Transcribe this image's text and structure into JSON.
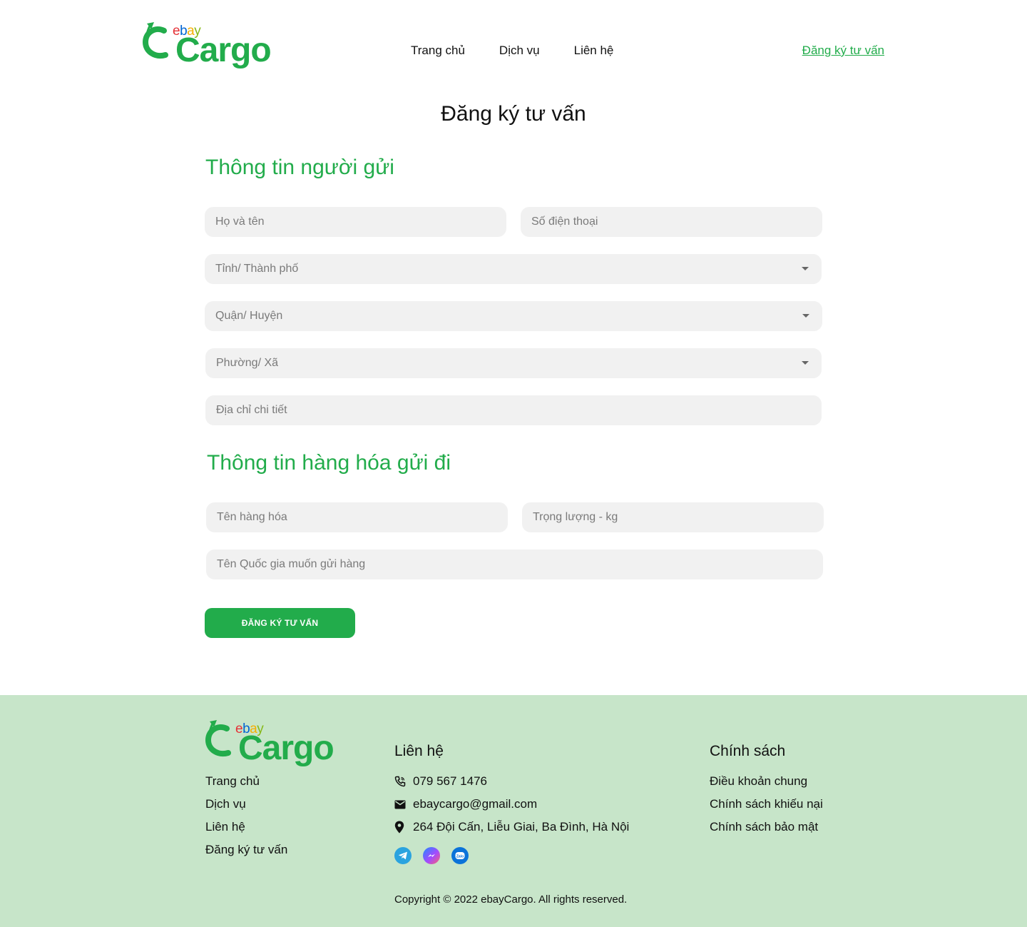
{
  "brand": {
    "ebay": [
      "e",
      "b",
      "a",
      "y"
    ],
    "cargo": "Cargo",
    "green": "#22ac4b",
    "footer_bg": "#c7e5c9"
  },
  "nav": {
    "home": "Trang chủ",
    "services": "Dịch vụ",
    "contact": "Liên hệ",
    "register": "Đăng ký tư vấn"
  },
  "page_title": "Đăng ký tư vấn",
  "sender": {
    "title": "Thông tin người gửi",
    "full_name_placeholder": "Họ và tên",
    "phone_placeholder": "Số điện thoại",
    "province_placeholder": "Tỉnh/ Thành phố",
    "district_placeholder": "Quận/ Huyện",
    "ward_placeholder": "Phường/ Xã",
    "address_placeholder": "Địa chỉ chi tiết"
  },
  "goods": {
    "title": "Thông tin hàng hóa gửi đi",
    "name_placeholder": "Tên hàng hóa",
    "weight_placeholder": "Trọng lượng - kg",
    "country_placeholder": "Tên Quốc gia muốn gửi hàng"
  },
  "submit_label": "ĐĂNG KÝ TƯ VẤN",
  "footer": {
    "links": [
      "Trang chủ",
      "Dịch vụ",
      "Liên hệ",
      "Đăng ký tư vấn"
    ],
    "contact_heading": "Liên hệ",
    "phone": "079 567 1476",
    "email": "ebaycargo@gmail.com",
    "address": "264 Đội Cấn, Liễu Giai, Ba Đình, Hà Nội",
    "social_icons": [
      "telegram-icon",
      "messenger-icon",
      "zalo-icon"
    ],
    "policy_heading": "Chính sách",
    "policies": [
      "Điều khoản chung",
      "Chính sách khiếu nại",
      "Chính sách bảo mật"
    ],
    "copyright": "Copyright © 2022 ebayCargo. All rights reserved."
  }
}
